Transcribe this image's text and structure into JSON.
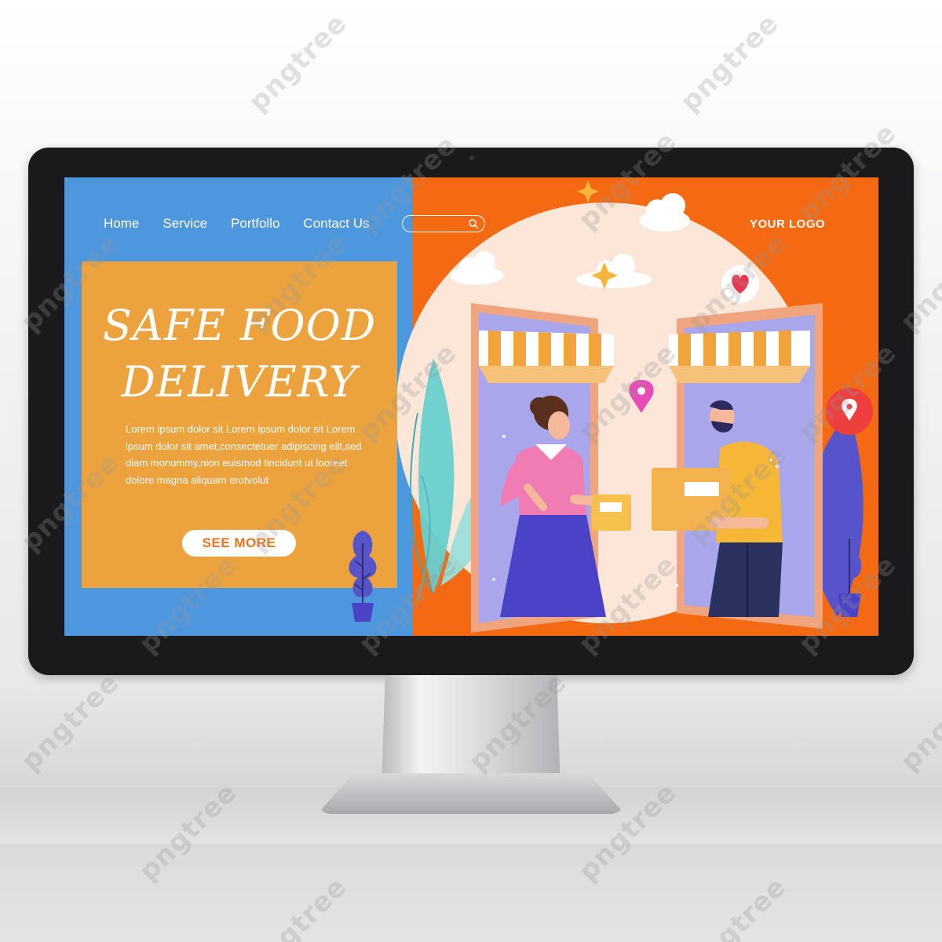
{
  "nav": {
    "items": [
      {
        "label": "Home"
      },
      {
        "label": "Service"
      },
      {
        "label": "Portfollo"
      },
      {
        "label": "Contact Us"
      }
    ]
  },
  "search": {
    "placeholder": "",
    "icon": "search-icon"
  },
  "logo": {
    "text": "YOUR LOGO"
  },
  "hero": {
    "headline_line1": "SAFE FOOD",
    "headline_line2": "DELIVERY",
    "body": "Lorem ipsum dolor sit Lorem ipsum dolor sit Lorem ipsum dolor sit amet,consectetuer adipiscing eilt,sed diam monummy,nion euismod tincidunt ut looreet dolore magna aliquam erotvolut",
    "cta_label": "SEE MORE"
  },
  "watermark": {
    "text": "pngtree"
  },
  "colors": {
    "blue_panel": "#4d97de",
    "orange_panel": "#f36a12",
    "card": "#eca33d",
    "cta_text": "#e9751f"
  },
  "icons": [
    "search-icon",
    "heart-icon",
    "location-pin-icon",
    "cloud-icon",
    "sparkle-icon",
    "plant-icon"
  ]
}
